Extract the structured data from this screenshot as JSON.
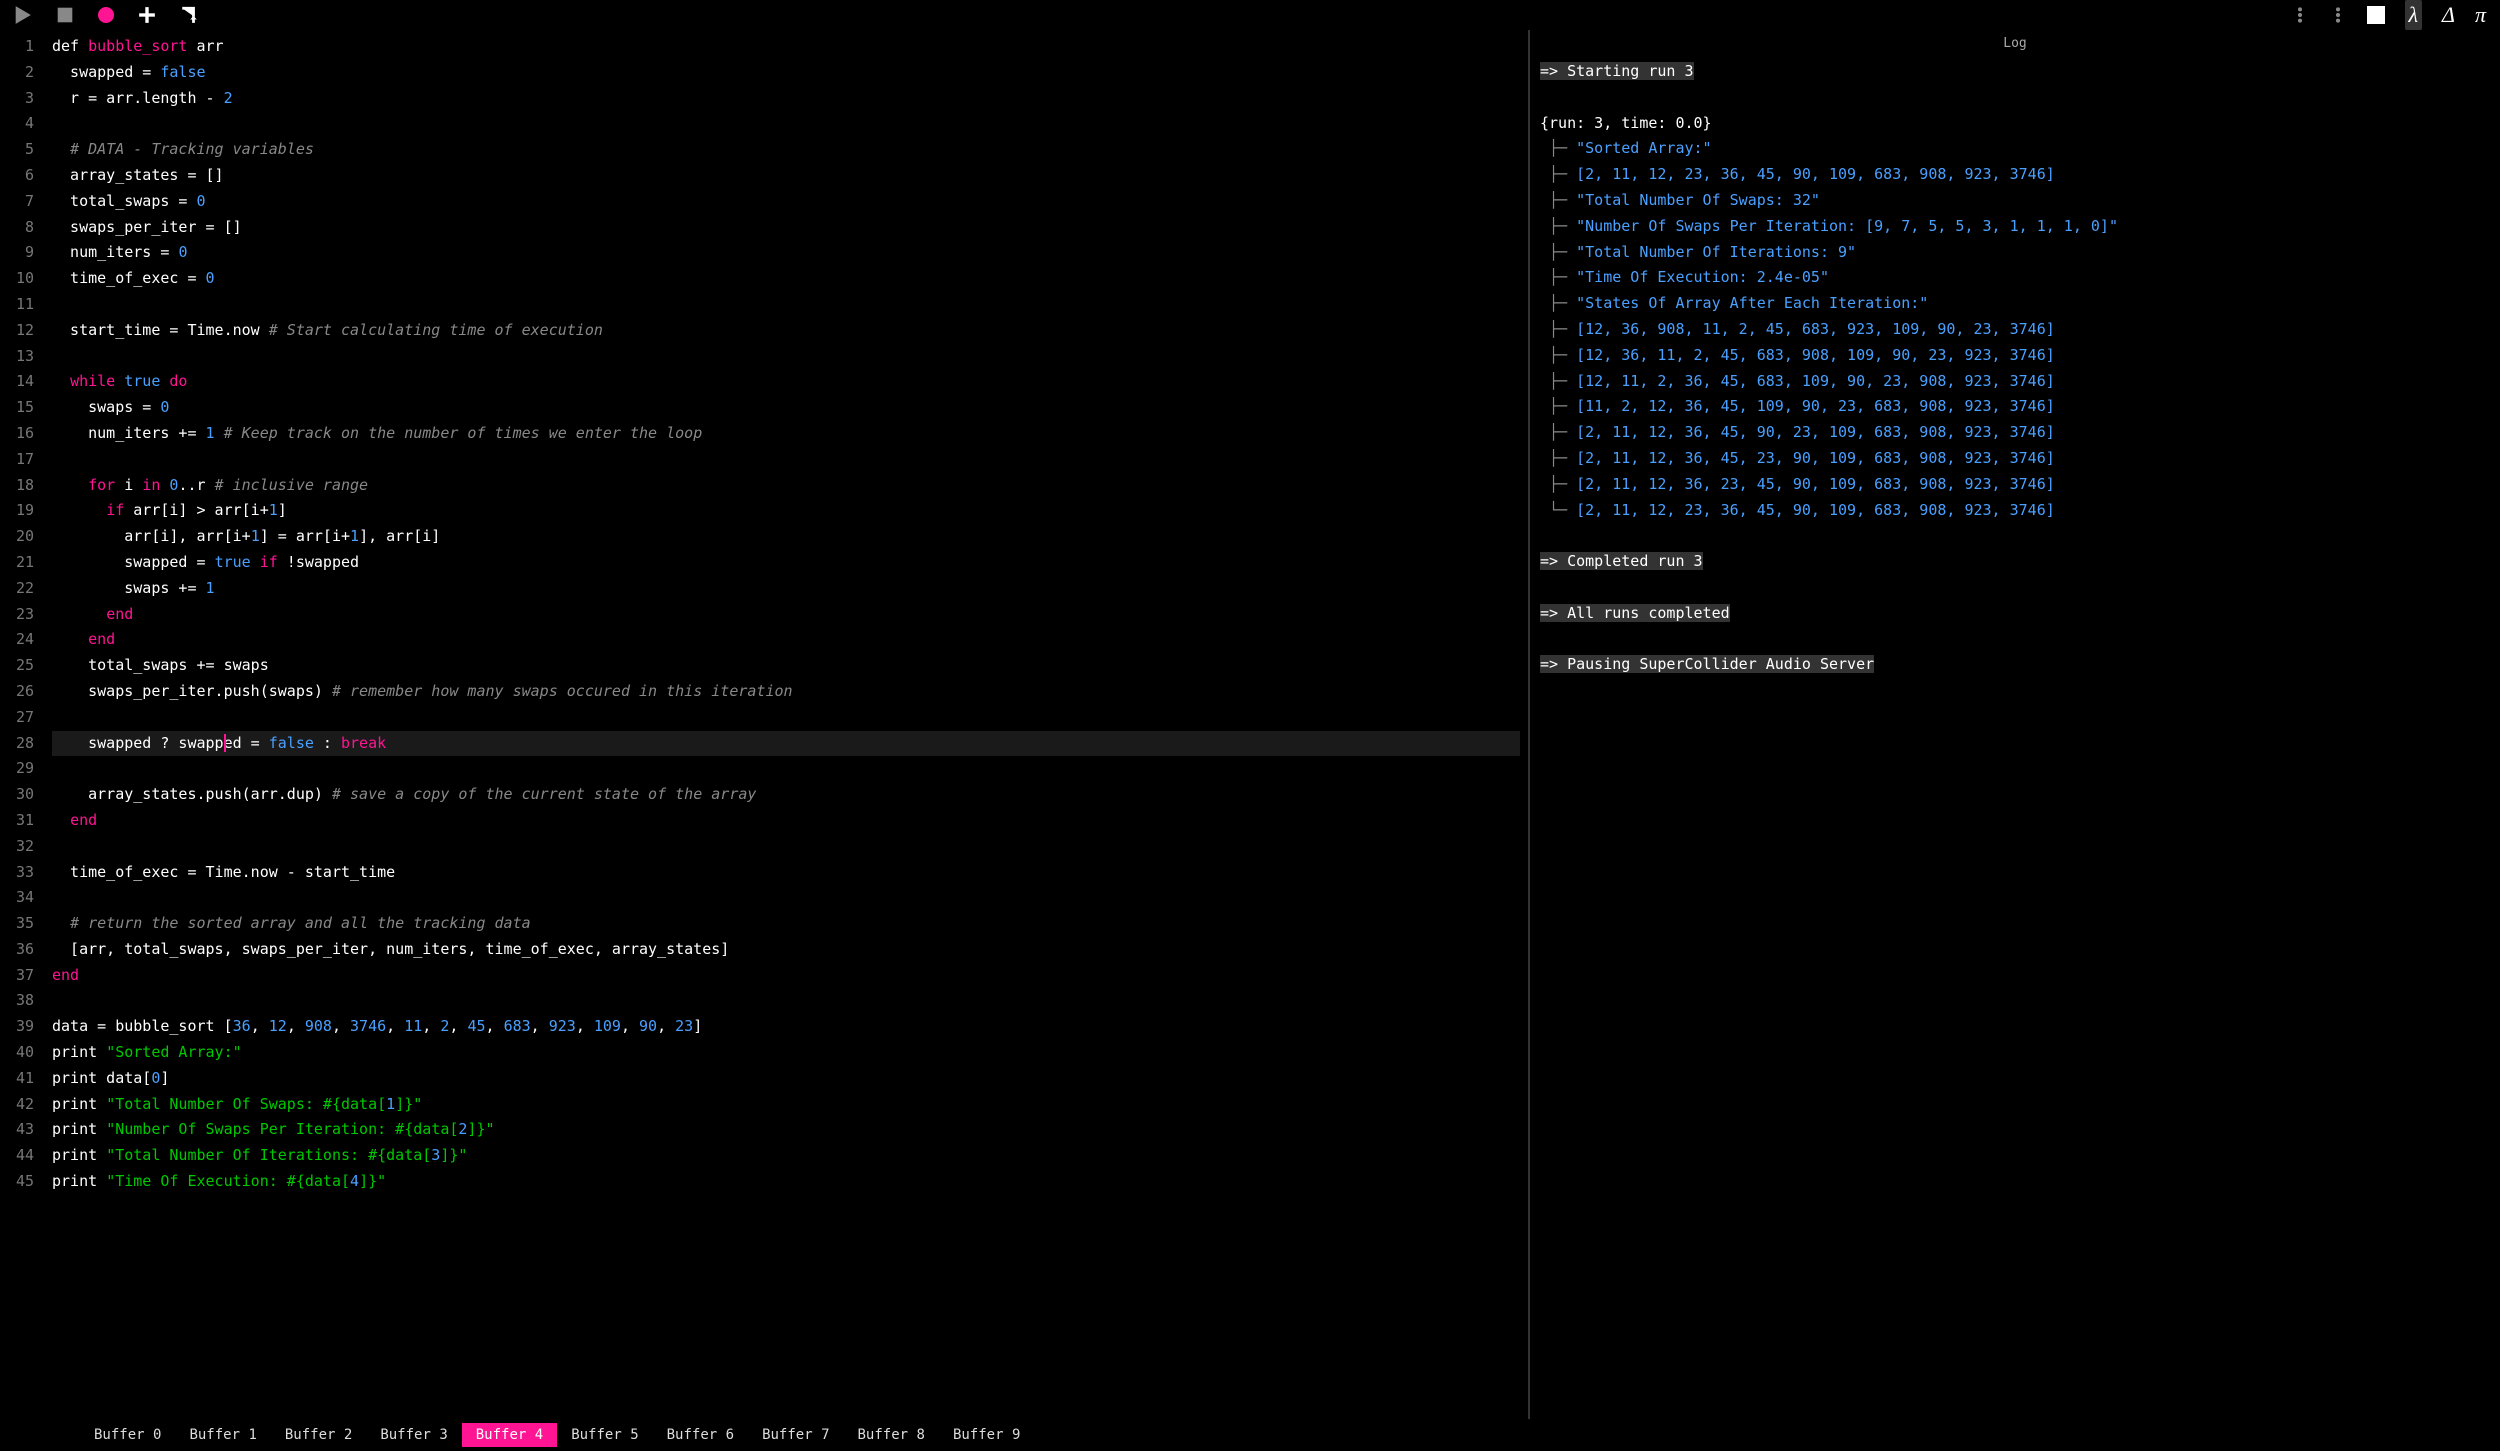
{
  "toolbar": {
    "icons_right_greek": [
      "λ",
      "Δ",
      "π"
    ]
  },
  "log": {
    "title": "Log",
    "start": "=> Starting run 3",
    "meta": "{run: 3, time: 0.0}",
    "lines": [
      "\"Sorted Array:\"",
      "[2, 11, 12, 23, 36, 45, 90, 109, 683, 908, 923, 3746]",
      "\"Total Number Of Swaps: 32\"",
      "\"Number Of Swaps Per Iteration: [9, 7, 5, 5, 3, 1, 1, 1, 0]\"",
      "\"Total Number Of Iterations: 9\"",
      "\"Time Of Execution: 2.4e-05\"",
      "\"States Of Array After Each Iteration:\"",
      "[12, 36, 908, 11, 2, 45, 683, 923, 109, 90, 23, 3746]",
      "[12, 36, 11, 2, 45, 683, 908, 109, 90, 23, 923, 3746]",
      "[12, 11, 2, 36, 45, 683, 109, 90, 23, 908, 923, 3746]",
      "[11, 2, 12, 36, 45, 109, 90, 23, 683, 908, 923, 3746]",
      "[2, 11, 12, 36, 45, 90, 23, 109, 683, 908, 923, 3746]",
      "[2, 11, 12, 36, 45, 23, 90, 109, 683, 908, 923, 3746]",
      "[2, 11, 12, 36, 23, 45, 90, 109, 683, 908, 923, 3746]",
      "[2, 11, 12, 23, 36, 45, 90, 109, 683, 908, 923, 3746]"
    ],
    "completed": "=> Completed run 3",
    "all_done": "=> All runs completed",
    "pause": "=> Pausing SuperCollider Audio Server"
  },
  "buffers": [
    "Buffer 0",
    "Buffer 1",
    "Buffer 2",
    "Buffer 3",
    "Buffer 4",
    "Buffer 5",
    "Buffer 6",
    "Buffer 7",
    "Buffer 8",
    "Buffer 9"
  ],
  "active_buffer": 4,
  "code": [
    {
      "n": 1,
      "html": "<span class='kw-def'>def</span> <span class='kw-fn'>bubble_sort</span> arr"
    },
    {
      "n": 2,
      "html": "  swapped = <span class='kw-bool'>false</span>"
    },
    {
      "n": 3,
      "html": "  r = arr.length - <span class='kw-num'>2</span>"
    },
    {
      "n": 4,
      "html": ""
    },
    {
      "n": 5,
      "html": "  <span class='kw-comment'># DATA - Tracking variables</span>"
    },
    {
      "n": 6,
      "html": "  array_states = []"
    },
    {
      "n": 7,
      "html": "  total_swaps = <span class='kw-num'>0</span>"
    },
    {
      "n": 8,
      "html": "  swaps_per_iter = []"
    },
    {
      "n": 9,
      "html": "  num_iters = <span class='kw-num'>0</span>"
    },
    {
      "n": 10,
      "html": "  time_of_exec = <span class='kw-num'>0</span>"
    },
    {
      "n": 11,
      "html": ""
    },
    {
      "n": 12,
      "html": "  start_time = Time.now <span class='kw-comment'># Start calculating time of execution</span>"
    },
    {
      "n": 13,
      "html": ""
    },
    {
      "n": 14,
      "html": "  <span class='kw-ctrl'>while</span> <span class='kw-bool'>true</span> <span class='kw-ctrl'>do</span>"
    },
    {
      "n": 15,
      "html": "    swaps = <span class='kw-num'>0</span>"
    },
    {
      "n": 16,
      "html": "    num_iters += <span class='kw-num'>1</span> <span class='kw-comment'># Keep track on the number of times we enter the loop</span>"
    },
    {
      "n": 17,
      "html": ""
    },
    {
      "n": 18,
      "html": "    <span class='kw-ctrl'>for</span> i <span class='kw-ctrl'>in</span> <span class='kw-num'>0</span>..r <span class='kw-comment'># inclusive range</span>"
    },
    {
      "n": 19,
      "html": "      <span class='kw-ctrl'>if</span> arr[i] &gt; arr[i+<span class='kw-num'>1</span>]"
    },
    {
      "n": 20,
      "html": "        arr[i], arr[i+<span class='kw-num'>1</span>] = arr[i+<span class='kw-num'>1</span>], arr[i]"
    },
    {
      "n": 21,
      "html": "        swapped = <span class='kw-bool'>true</span> <span class='kw-ctrl'>if</span> !swapped"
    },
    {
      "n": 22,
      "html": "        swaps += <span class='kw-num'>1</span>"
    },
    {
      "n": 23,
      "html": "      <span class='kw-ctrl'>end</span>"
    },
    {
      "n": 24,
      "html": "    <span class='kw-ctrl'>end</span>"
    },
    {
      "n": 25,
      "html": "    total_swaps += swaps"
    },
    {
      "n": 26,
      "html": "    swaps_per_iter.push(swaps) <span class='kw-comment'># remember how many swaps occured in this iteration</span>"
    },
    {
      "n": 27,
      "html": ""
    },
    {
      "n": 28,
      "current": true,
      "html": "    swapped ? swapp<span class='cursor-mark'></span>ed = <span class='kw-bool'>false</span> : <span class='kw-ctrl'>break</span>"
    },
    {
      "n": 29,
      "html": ""
    },
    {
      "n": 30,
      "html": "    array_states.push(arr.dup) <span class='kw-comment'># save a copy of the current state of the array</span>"
    },
    {
      "n": 31,
      "html": "  <span class='kw-ctrl'>end</span>"
    },
    {
      "n": 32,
      "html": ""
    },
    {
      "n": 33,
      "html": "  time_of_exec = Time.now - start_time"
    },
    {
      "n": 34,
      "html": ""
    },
    {
      "n": 35,
      "html": "  <span class='kw-comment'># return the sorted array and all the tracking data</span>"
    },
    {
      "n": 36,
      "html": "  [arr, total_swaps, swaps_per_iter, num_iters, time_of_exec, array_states]"
    },
    {
      "n": 37,
      "html": "<span class='kw-ctrl'>end</span>"
    },
    {
      "n": 38,
      "html": ""
    },
    {
      "n": 39,
      "html": "data = bubble_sort [<span class='kw-num'>36</span>, <span class='kw-num'>12</span>, <span class='kw-num'>908</span>, <span class='kw-num'>3746</span>, <span class='kw-num'>11</span>, <span class='kw-num'>2</span>, <span class='kw-num'>45</span>, <span class='kw-num'>683</span>, <span class='kw-num'>923</span>, <span class='kw-num'>109</span>, <span class='kw-num'>90</span>, <span class='kw-num'>23</span>]"
    },
    {
      "n": 40,
      "html": "print <span class='kw-str'>\"Sorted Array:\"</span>"
    },
    {
      "n": 41,
      "html": "print data[<span class='kw-num'>0</span>]"
    },
    {
      "n": 42,
      "html": "print <span class='kw-str'>\"Total Number Of Swaps: #{data[</span><span class='kw-num'>1</span><span class='kw-str'>]}\"</span>"
    },
    {
      "n": 43,
      "html": "print <span class='kw-str'>\"Number Of Swaps Per Iteration: #{data[</span><span class='kw-num'>2</span><span class='kw-str'>]}\"</span>"
    },
    {
      "n": 44,
      "html": "print <span class='kw-str'>\"Total Number Of Iterations: #{data[</span><span class='kw-num'>3</span><span class='kw-str'>]}\"</span>"
    },
    {
      "n": 45,
      "html": "print <span class='kw-str'>\"Time Of Execution: #{data[</span><span class='kw-num'>4</span><span class='kw-str'>]}\"</span>"
    }
  ]
}
